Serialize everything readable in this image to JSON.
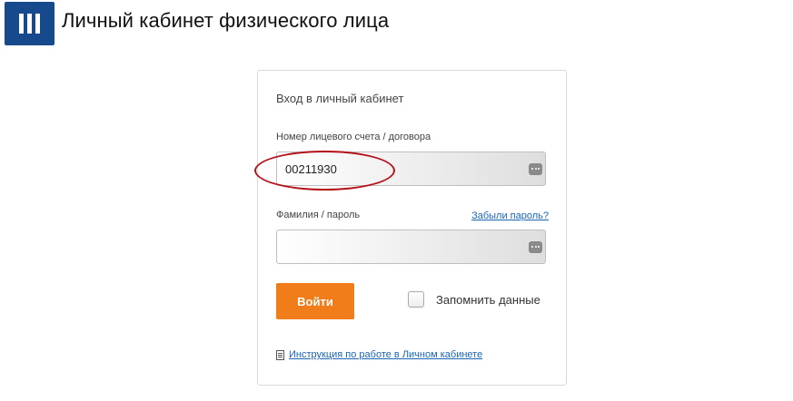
{
  "header": {
    "title": "Личный кабинет физического лица",
    "logo_icon": "bank-logo-icon",
    "logo_color": "#174a8c"
  },
  "login_form": {
    "title": "Вход в личный кабинет",
    "account_label": "Номер лицевого счета / договора",
    "account_value": "00211930",
    "password_label": "Фамилия / пароль",
    "forgot_link": "Забыли пароль?",
    "password_value": "",
    "keyboard_icon": "dots-keyboard-icon",
    "submit_label": "Войти",
    "submit_color": "#f07c1a",
    "remember_label": "Запомнить данные",
    "remember_checked": false,
    "instruction_link": "Инструкция по работе в Личном кабинете",
    "instruction_icon": "document-icon",
    "link_color": "#1a64b4",
    "annotation_color": "#b3121b"
  }
}
